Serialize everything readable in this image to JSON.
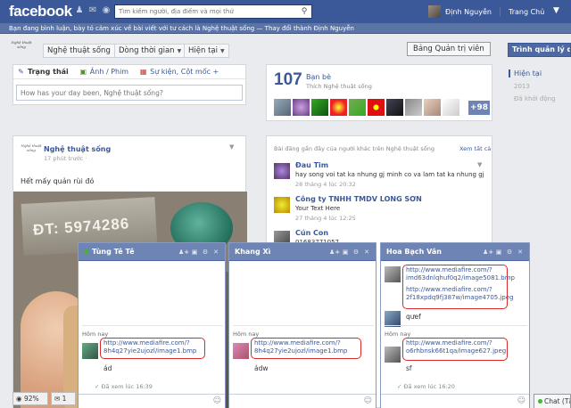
{
  "topbar": {
    "logo": "facebook",
    "search_placeholder": "Tìm kiếm người, địa điểm và mọi thứ",
    "user_name": "Định Nguyễn",
    "home_label": "Trang Chủ",
    "icons": [
      "friend-requests-icon",
      "messages-icon",
      "notifications-icon",
      "search-icon",
      "settings-icon"
    ]
  },
  "admin_strip": {
    "text": "Bạn đang bình luận, bày tỏ cảm xúc về bài viết với tư cách là Nghệ thuật sống — ",
    "switch_link": "Thay đổi thành Định Nguyễn"
  },
  "page_header": {
    "logo_text": "Nghệ thuật sống",
    "name_button": "Nghệ thuật sống",
    "timeline_button": "Dòng thời gian",
    "now_button": "Hiện tại",
    "admin_panel_button": "Bảng Quản trị viên",
    "manage_button": "Trình quản lý quảng cáo"
  },
  "timeline_years": [
    "Hiện tại",
    "2013",
    "Đã khởi động"
  ],
  "composer": {
    "tabs": [
      {
        "label": "Trạng thái",
        "icon": "pencil-icon"
      },
      {
        "label": "Ảnh / Phim",
        "icon": "photo-icon"
      },
      {
        "label": "Sự kiện, Cột mốc +",
        "icon": "calendar-icon"
      }
    ],
    "placeholder": "How has your day been, Nghệ thuật sống?"
  },
  "friends": {
    "count": "107",
    "label": "Bạn bè",
    "subtitle": "Thích Nghệ thuật sống",
    "more": "+98"
  },
  "post": {
    "author": "Nghệ thuật sống",
    "time": "17 phút trước · ",
    "text": "Hết mấy quản rùi đó",
    "photo_text": "ĐT: 5974286"
  },
  "activity": {
    "header": "Bài đăng gần đây của người khác trên Nghệ thuật sống",
    "see_all": "Xem tất cả",
    "items": [
      {
        "name": "Đau Tim",
        "text": "hay song voi tat ka nhung gj minh co va lam tat ka nhung gj",
        "time": "28 tháng 4 lúc 20:32"
      },
      {
        "name": "Công ty TNHH TMDV LONG SƠN",
        "text": "Your Text Here",
        "time": "27 tháng 4 lúc 12:25"
      },
      {
        "name": "Cún Con",
        "text": "01683771057",
        "time": ""
      }
    ]
  },
  "chats": [
    {
      "name": "Tùng Tê Tê",
      "online": true,
      "day": "Hôm nay",
      "link": "http://www.mediafire.com/?8h4q27yie2ujozl/image1.bmp",
      "reply": "ád",
      "seen": "Đã xem lúc 16:39"
    },
    {
      "name": "Khang Xì",
      "online": false,
      "day": "Hôm nay",
      "link": "http://www.mediafire.com/?8h4q27yie2ujozl/image1.bmp",
      "reply": "ádw",
      "seen": ""
    },
    {
      "name": "Hoa Bạch Vân",
      "online": false,
      "day": "Hôm nay",
      "links": [
        "http://www.mediafire.com/?imd63dnlqhuf0q2/image5081.bmp",
        "http://www.mediafire.com/?2f18xpdq9fj387w/image4705.jpeg"
      ],
      "reply1": "qưef",
      "link3": "http://www.mediafire.com/?o6rhbnsk66t1qa/image627.jpeg",
      "reply2": "sf",
      "seen": "Đã xem lúc 16:20"
    }
  ],
  "bottom": {
    "zoom": "92%",
    "notify": "1",
    "chat_label": "Chat (Tắt)"
  },
  "colors": {
    "brand": "#3b5998",
    "chat_header": "#6d84b4",
    "highlight": "#d82a2a",
    "online": "#42b72a"
  }
}
